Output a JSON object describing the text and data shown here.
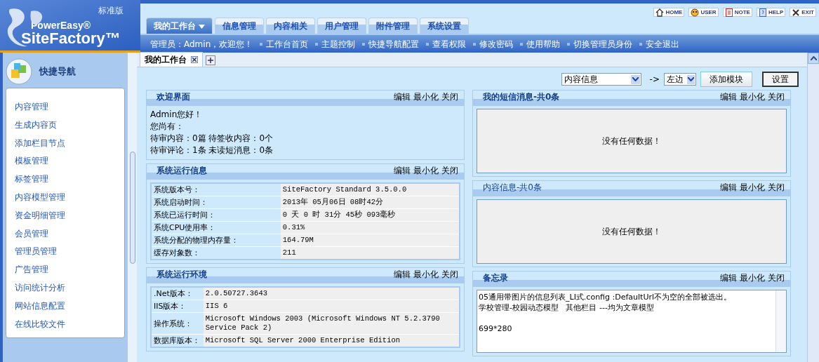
{
  "header": {
    "logo_top": "PowerEasy®",
    "logo_main": "SiteFactory™",
    "edition": "标准版",
    "quick_links": [
      {
        "label": "HOME"
      },
      {
        "label": "USER"
      },
      {
        "label": "NOTE"
      },
      {
        "label": "HELP"
      },
      {
        "label": "EXIT"
      }
    ],
    "tabs": [
      {
        "label": "我的工作台",
        "selected": true,
        "has_menu": true
      },
      {
        "label": "信息管理",
        "selected": false,
        "has_menu": false
      },
      {
        "label": "内容相关",
        "selected": false,
        "has_menu": false
      },
      {
        "label": "用户管理",
        "selected": false,
        "has_menu": false
      },
      {
        "label": "附件管理",
        "selected": false,
        "has_menu": false
      },
      {
        "label": "系统设置",
        "selected": false,
        "has_menu": false
      }
    ],
    "admin_greeting": "管理员：Admin，欢迎您！",
    "nav_links": [
      "工作台首页",
      "主题控制",
      "快捷导航配置",
      "查看权限",
      "修改密码",
      "使用帮助",
      "切换管理员身份",
      "安全退出"
    ]
  },
  "sidebar": {
    "title": "快捷导航",
    "items": [
      "内容管理",
      "生成内容页",
      "添加栏目节点",
      "模板管理",
      "标签管理",
      "内容模型管理",
      "资金明细管理",
      "会员管理",
      "管理员管理",
      "广告管理",
      "访问统计分析",
      "网站信息配置",
      "在线比较文件"
    ]
  },
  "workspace_tabs": [
    {
      "label": "我的工作台",
      "selected": true
    }
  ],
  "toolbar": {
    "module_select": "内容信息",
    "arrow": "->",
    "position_select": "左边",
    "add_button": "添加模块",
    "settings_button": "设置"
  },
  "columns": [
    [
      {
        "kind": "text",
        "title": "欢迎界面",
        "emphasized": true,
        "actions": [
          "编辑",
          "最小化",
          "关闭"
        ],
        "lines": [
          "Admin您好！",
          "您尚有：",
          "待审内容：0篇 待签收内容：0个",
          "待审评论：1条 未读短消息：0条"
        ]
      },
      {
        "kind": "table",
        "title": "系统运行信息",
        "emphasized": true,
        "actions": [
          "编辑",
          "最小化",
          "关闭"
        ],
        "rows": [
          [
            "系统版本号：",
            "SiteFactory Standard 3.5.0.0"
          ],
          [
            "系统启动时间：",
            "2013年 05月06日 08时42分"
          ],
          [
            "系统已运行时间：",
            "0 天 0 时 31分 45秒 093毫秒"
          ],
          [
            "系统CPU使用率：",
            "0.31%"
          ],
          [
            "系统分配的物理内存量：",
            "164.79M"
          ],
          [
            "缓存对象数：",
            "211"
          ]
        ]
      },
      {
        "kind": "table",
        "title": "系统运行环境",
        "emphasized": true,
        "actions": [
          "编辑",
          "最小化",
          "关闭"
        ],
        "rows": [
          [
            ".Net版本：",
            "2.0.50727.3643"
          ],
          [
            "IIS版本：",
            "IIS 6"
          ],
          [
            "操作系统：",
            "Microsoft Windows 2003 (Microsoft Windows NT 5.2.3790 Service Pack 2)"
          ],
          [
            "数据库版本：",
            "Microsoft SQL Server 2000 Enterprise Edition"
          ]
        ]
      }
    ],
    [
      {
        "kind": "empty",
        "title": "我的短信消息-共0条",
        "emphasized": true,
        "actions": [
          "编辑",
          "最小化",
          "关闭"
        ],
        "message": "没有任何数据！"
      },
      {
        "kind": "empty",
        "title": "内容信息-共0条",
        "emphasized": false,
        "actions": [
          "编辑",
          "最小化",
          "关闭"
        ],
        "message": "没有任何数据！"
      },
      {
        "kind": "memo",
        "title": "备忘录",
        "emphasized": true,
        "actions": [
          "编辑",
          "最小化",
          "关闭"
        ],
        "lines": [
          {
            "text": "05通用带图片的信息列表_LI式.config :DefaultUrl不为空的全部被选出。",
            "gap_before": false
          },
          {
            "text": "学校管理-校园动态模型   其他栏目 ---均为文章模型",
            "gap_before": false
          },
          {
            "text": "699*280",
            "gap_before": true
          }
        ]
      }
    ]
  ]
}
